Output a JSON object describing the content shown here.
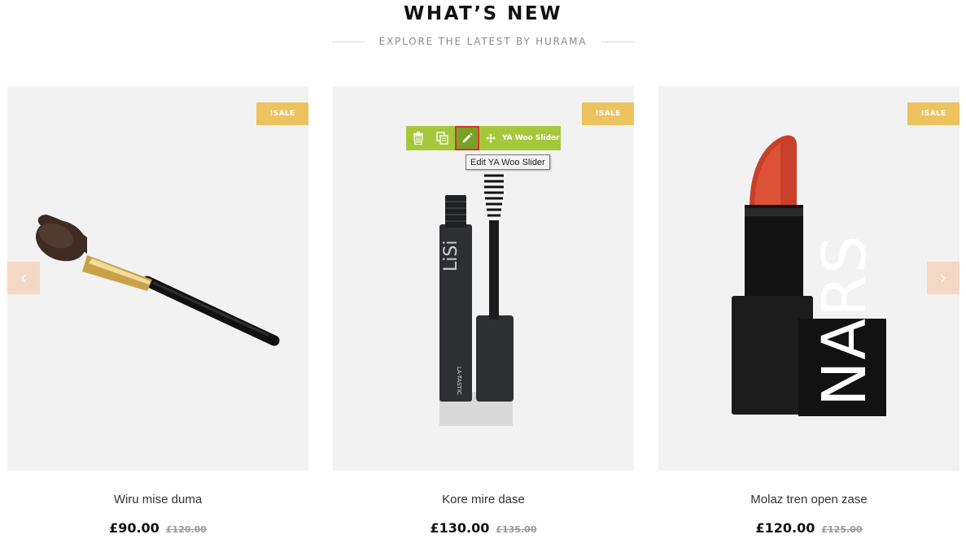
{
  "section": {
    "title": "WHAT’S NEW",
    "subtitle": "EXPLORE THE LATEST BY HURAMA"
  },
  "products": [
    {
      "name": "Wiru mise duma",
      "price": "£90.00",
      "old_price": "£120.00",
      "badge": "!SALE"
    },
    {
      "name": "Kore mire dase",
      "price": "£130.00",
      "old_price": "£135.00",
      "badge": "!SALE"
    },
    {
      "name": "Molaz tren open zase",
      "price": "£120.00",
      "old_price": "£125.00",
      "badge": "!SALE"
    }
  ],
  "carousel": {
    "prev_icon": "‹",
    "next_icon": "›"
  },
  "edit_toolbar": {
    "widget_label": "YA Woo Slider",
    "tooltip": "Edit YA Woo Slider",
    "icons": [
      "trash-icon",
      "duplicate-icon",
      "pencil-icon",
      "move-icon"
    ]
  },
  "colors": {
    "sale_badge": "#ecc35f",
    "toolbar": "#a4c83a",
    "arrow_bg": "#f4d8c4",
    "card_bg": "#f3f2f2"
  }
}
